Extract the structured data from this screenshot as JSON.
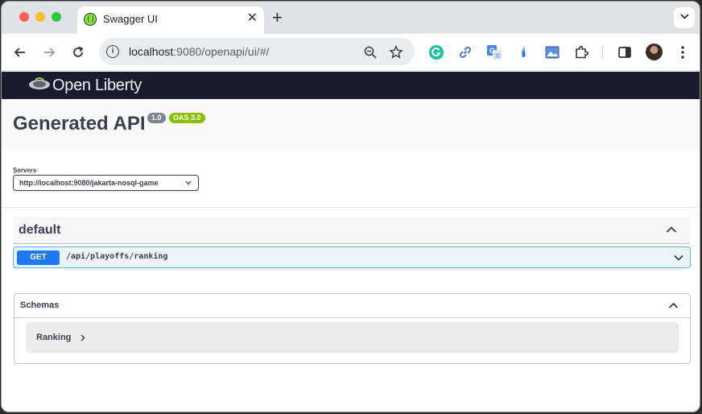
{
  "browser": {
    "tab_title": "Swagger UI",
    "url_host": "localhost",
    "url_rest": ":9080/openapi/ui/#/"
  },
  "header": {
    "logo_text": "Open Liberty"
  },
  "api": {
    "title": "Generated API",
    "version": "1.0",
    "oas_version": "OAS 3.0"
  },
  "servers": {
    "label": "Servers",
    "selected": "http://localhost:9080/jakarta-nosql-game"
  },
  "tags": [
    {
      "name": "default",
      "operations": [
        {
          "method": "GET",
          "path": "/api/playoffs/ranking"
        }
      ]
    }
  ],
  "schemas": {
    "title": "Schemas",
    "models": [
      "Ranking"
    ]
  }
}
